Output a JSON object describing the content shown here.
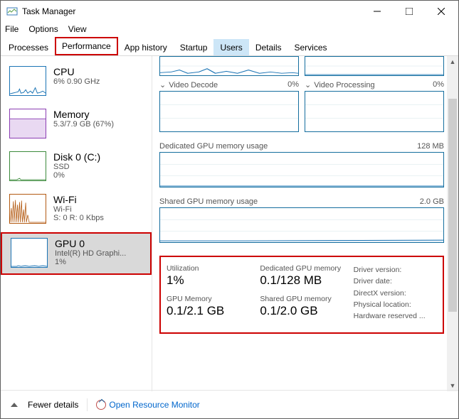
{
  "window": {
    "title": "Task Manager",
    "menu": [
      "File",
      "Options",
      "View"
    ]
  },
  "tabs": [
    "Processes",
    "Performance",
    "App history",
    "Startup",
    "Users",
    "Details",
    "Services"
  ],
  "sidebar": [
    {
      "name": "CPU",
      "sub1": "6% 0.90 GHz",
      "sub2": "",
      "color": "#1b74b5"
    },
    {
      "name": "Memory",
      "sub1": "5.3/7.9 GB (67%)",
      "sub2": "",
      "color": "#8b3db3"
    },
    {
      "name": "Disk 0 (C:)",
      "sub1": "SSD",
      "sub2": "0%",
      "color": "#3b8a3b"
    },
    {
      "name": "Wi-Fi",
      "sub1": "Wi-Fi",
      "sub2": "S: 0 R: 0 Kbps",
      "color": "#b35a12"
    },
    {
      "name": "GPU 0",
      "sub1": "Intel(R) HD Graphi...",
      "sub2": "1%",
      "color": "#1b74b5"
    }
  ],
  "gpu": {
    "videoDecode": {
      "label": "Video Decode",
      "value": "0%"
    },
    "videoProcessing": {
      "label": "Video Processing",
      "value": "0%"
    },
    "dedicated": {
      "label": "Dedicated GPU memory usage",
      "value": "128 MB"
    },
    "shared": {
      "label": "Shared GPU memory usage",
      "value": "2.0 GB"
    }
  },
  "stats": {
    "utilization": {
      "label": "Utilization",
      "value": "1%"
    },
    "dedicated": {
      "label": "Dedicated GPU memory",
      "value": "0.1/128 MB"
    },
    "gpumem": {
      "label": "GPU Memory",
      "value": "0.1/2.1 GB"
    },
    "sharedmem": {
      "label": "Shared GPU memory",
      "value": "0.1/2.0 GB"
    },
    "right": [
      "Driver version:",
      "Driver date:",
      "DirectX version:",
      "Physical location:",
      "Hardware reserved ..."
    ]
  },
  "footer": {
    "fewer": "Fewer details",
    "link": "Open Resource Monitor"
  }
}
